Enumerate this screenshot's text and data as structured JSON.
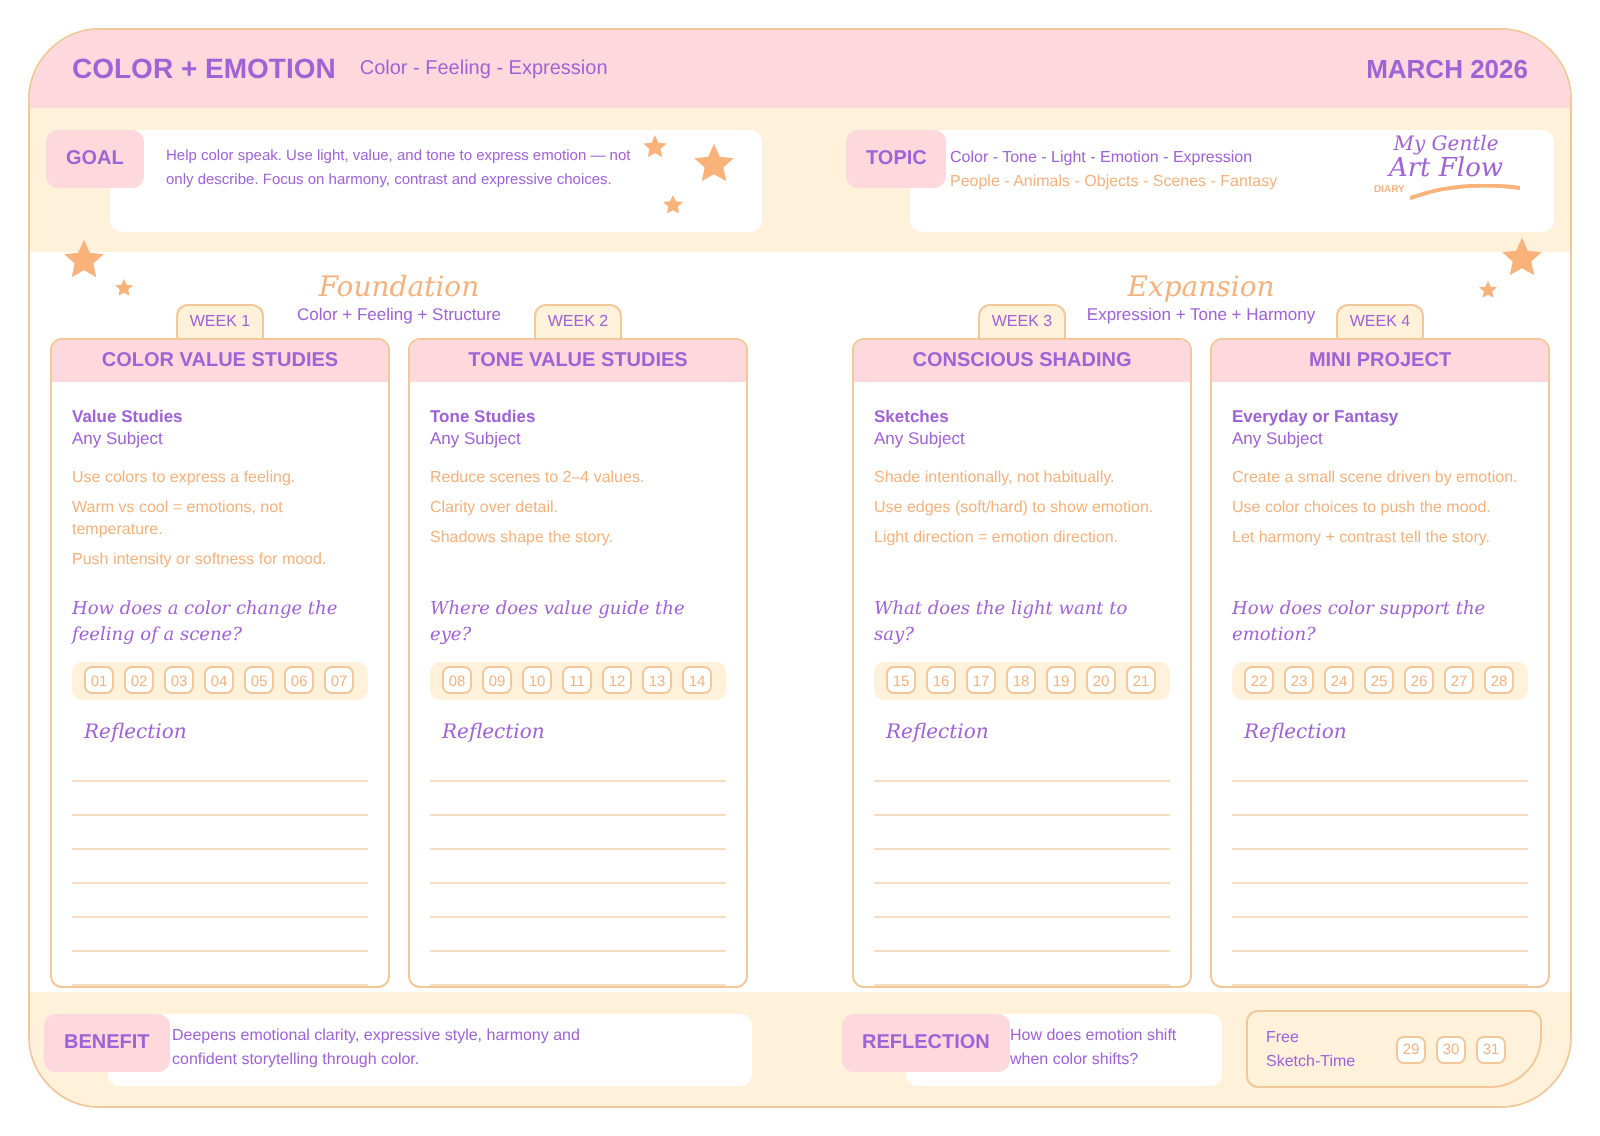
{
  "header": {
    "title": "COLOR + EMOTION",
    "subtitle": "Color - Feeling - Expression",
    "date": "MARCH 2026"
  },
  "goal": {
    "label": "GOAL",
    "text": "Help color speak. Use light, value, and tone to express emotion — not only describe. Focus on harmony, contrast and expressive choices."
  },
  "topic": {
    "label": "TOPIC",
    "line_1": "Color - Tone - Light - Emotion - Expression",
    "line_2": "People - Animals - Objects - Scenes - Fantasy"
  },
  "logo": {
    "line_1": "My Gentle",
    "line_2": "Art Flow",
    "tag": "DIARY"
  },
  "sections": [
    {
      "title": "Foundation",
      "subtitle": "Color + Feeling + Structure",
      "weeks": [
        {
          "week": "WEEK 1",
          "title": "COLOR VALUE STUDIES",
          "focus": "Value Studies",
          "subject": "Any Subject",
          "tips": [
            "Use colors to express a feeling.",
            "Warm vs cool = emotions, not temperature.",
            "Push intensity or softness for mood."
          ],
          "question": "How does a color change the feeling of a scene?",
          "days": [
            "01",
            "02",
            "03",
            "04",
            "05",
            "06",
            "07"
          ],
          "reflection_label": "Reflection"
        },
        {
          "week": "WEEK 2",
          "title": "TONE VALUE STUDIES",
          "focus": "Tone Studies",
          "subject": "Any Subject",
          "tips": [
            "Reduce scenes to 2–4 values.",
            "Clarity over detail.",
            "Shadows shape the story."
          ],
          "question": "Where does value guide the eye?",
          "days": [
            "08",
            "09",
            "10",
            "11",
            "12",
            "13",
            "14"
          ],
          "reflection_label": "Reflection"
        }
      ]
    },
    {
      "title": "Expansion",
      "subtitle": "Expression + Tone + Harmony",
      "weeks": [
        {
          "week": "WEEK 3",
          "title": "CONSCIOUS SHADING",
          "focus": "Sketches",
          "subject": "Any Subject",
          "tips": [
            "Shade intentionally, not habitually.",
            "Use edges (soft/hard) to show emotion.",
            "Light direction = emotion direction."
          ],
          "question": "What does the light want to say?",
          "days": [
            "15",
            "16",
            "17",
            "18",
            "19",
            "20",
            "21"
          ],
          "reflection_label": "Reflection"
        },
        {
          "week": "WEEK 4",
          "title": "MINI PROJECT",
          "focus": "Everyday or Fantasy",
          "subject": "Any Subject",
          "tips": [
            "Create a small scene driven by emotion.",
            "Use color choices to push the mood.",
            "Let harmony + contrast tell the story."
          ],
          "question": "How does color support the emotion?",
          "days": [
            "22",
            "23",
            "24",
            "25",
            "26",
            "27",
            "28"
          ],
          "reflection_label": "Reflection"
        }
      ]
    }
  ],
  "footer": {
    "benefit": {
      "label": "BENEFIT",
      "text": "Deepens emotional clarity, expressive style, harmony and confident storytelling through color."
    },
    "reflection": {
      "label": "REFLECTION",
      "text": "How does emotion shift when color shifts?"
    },
    "free": {
      "label_1": "Free",
      "label_2": "Sketch-Time",
      "days": [
        "29",
        "30",
        "31"
      ]
    }
  }
}
